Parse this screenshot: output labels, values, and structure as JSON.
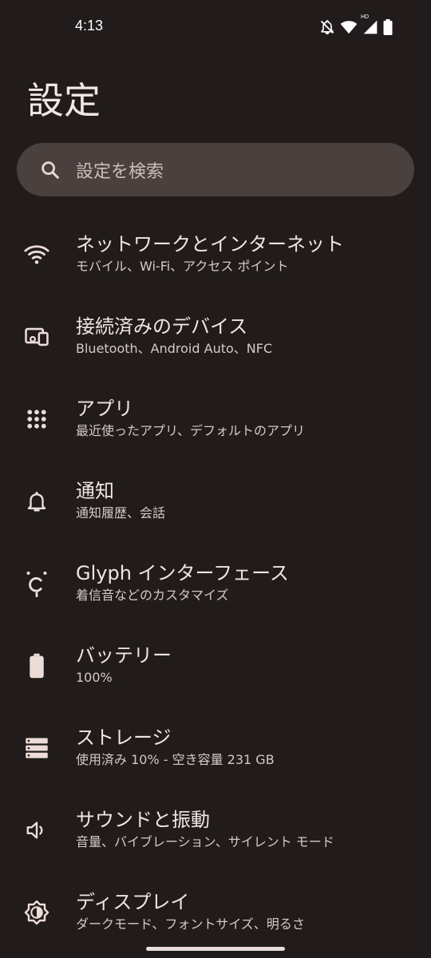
{
  "status_bar": {
    "time": "4:13",
    "icons": [
      "bell-off-icon",
      "wifi-icon",
      "signal-icon",
      "battery-icon"
    ],
    "signal_badge": "HD"
  },
  "page": {
    "title": "設定"
  },
  "search": {
    "placeholder": "設定を検索"
  },
  "settings": {
    "items": [
      {
        "icon": "wifi-icon",
        "title": "ネットワークとインターネット",
        "subtitle": "モバイル、Wi-Fi、アクセス ポイント"
      },
      {
        "icon": "connected-devices-icon",
        "title": "接続済みのデバイス",
        "subtitle": "Bluetooth、Android Auto、NFC"
      },
      {
        "icon": "apps-grid-icon",
        "title": "アプリ",
        "subtitle": "最近使ったアプリ、デフォルトのアプリ"
      },
      {
        "icon": "bell-icon",
        "title": "通知",
        "subtitle": "通知履歴、会話"
      },
      {
        "icon": "glyph-icon",
        "title": "Glyph インターフェース",
        "subtitle": "着信音などのカスタマイズ"
      },
      {
        "icon": "battery-icon",
        "title": "バッテリー",
        "subtitle": "100%"
      },
      {
        "icon": "storage-icon",
        "title": "ストレージ",
        "subtitle": "使用済み 10% - 空き容量 231 GB"
      },
      {
        "icon": "speaker-icon",
        "title": "サウンドと振動",
        "subtitle": "音量、バイブレーション、サイレント モード"
      },
      {
        "icon": "brightness-icon",
        "title": "ディスプレイ",
        "subtitle": "ダークモード、フォントサイズ、明るさ"
      }
    ]
  },
  "colors": {
    "background": "#211c1b",
    "search_bg": "#4a403e",
    "text_primary": "#f1e4e1",
    "text_secondary": "#d6c8c5",
    "icon": "#ecdcd8"
  }
}
